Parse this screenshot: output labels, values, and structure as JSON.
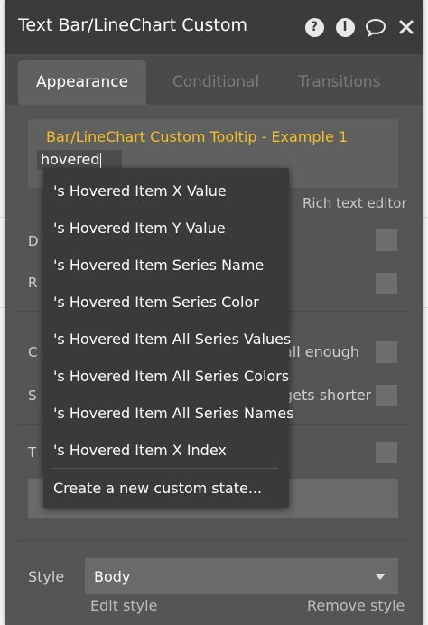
{
  "panel": {
    "title": "Text Bar/LineChart Custom",
    "icons": [
      "question-icon",
      "info-icon",
      "comment-icon",
      "close-icon"
    ]
  },
  "tabs": [
    {
      "label": "Appearance",
      "active": true
    },
    {
      "label": "Conditional",
      "active": false
    },
    {
      "label": "Transitions",
      "active": false
    }
  ],
  "editor": {
    "tooltip_text": "Bar/LineChart Custom Tooltip - Example 1",
    "input_value": "hovered",
    "rich_text_link": "Rich text editor",
    "highlight_color": "#f5c023"
  },
  "rows": {
    "row1_label": "D",
    "row2_label": "R",
    "row3_label": "C",
    "row3_tail": "all enough",
    "row4_label": "S",
    "row4_tail": "gets shorter",
    "row5_label": "T"
  },
  "dropdown": {
    "items": [
      "'s Hovered Item X Value",
      "'s Hovered Item Y Value",
      "'s Hovered Item Series Name",
      "'s Hovered Item Series Color",
      "'s Hovered Item All Series Values",
      "'s Hovered Item All Series Colors",
      "'s Hovered Item All Series Names",
      "'s Hovered Item X Index"
    ],
    "create_label": "Create a new custom state..."
  },
  "style": {
    "label": "Style",
    "value": "Body",
    "edit_link": "Edit style",
    "remove_link": "Remove style"
  }
}
